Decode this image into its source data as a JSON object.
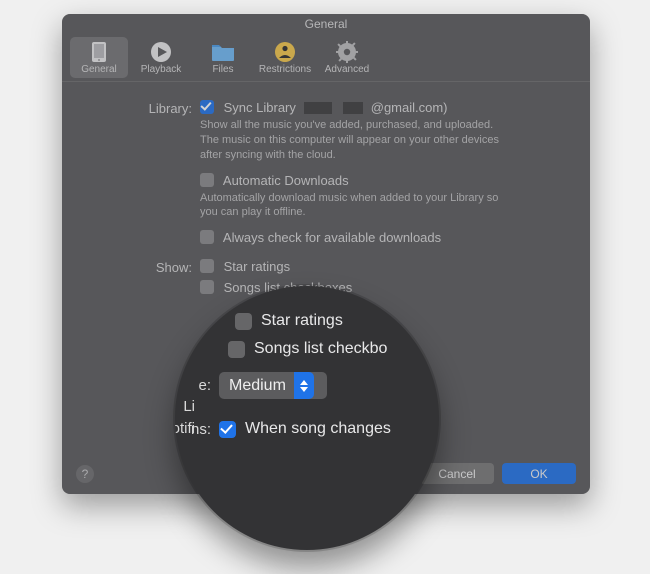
{
  "window": {
    "title": "General"
  },
  "toolbar": {
    "tabs": [
      {
        "label": "General"
      },
      {
        "label": "Playback"
      },
      {
        "label": "Files"
      },
      {
        "label": "Restrictions"
      },
      {
        "label": "Advanced"
      }
    ],
    "selectedIndex": 0
  },
  "labels": {
    "library": "Library:",
    "show": "Show:",
    "listSize": "List Size:",
    "notifications": "Notifications:"
  },
  "library": {
    "syncLibraryLabel": "Sync Library",
    "emailSuffix": "@gmail.com)",
    "hint": "Show all the music you've added, purchased, and uploaded. The music on this computer will appear on your other devices after syncing with the cloud.",
    "autoDownloadsLabel": "Automatic Downloads",
    "autoHint": "Automatically download music when added to your Library so you can play it offline.",
    "alwaysCheckLabel": "Always check for available downloads"
  },
  "show": {
    "starRatingsLabel": "Star ratings",
    "songsChecksLabel": "Songs list checkboxes"
  },
  "listSize": {
    "selected": "Medium"
  },
  "notifications": {
    "whenSongChangesLabel": "When song changes"
  },
  "buttons": {
    "cancel": "Cancel",
    "ok": "OK"
  },
  "magnifier": {
    "starRatings": "Star ratings",
    "songsChecks": "Songs list checkbo",
    "sizeLabelFragment": "e:",
    "listFragment": "Li",
    "notifFragment": "Notifi",
    "notifFragment2": "ns:",
    "medium": "Medium",
    "whenSong": "When song changes"
  }
}
